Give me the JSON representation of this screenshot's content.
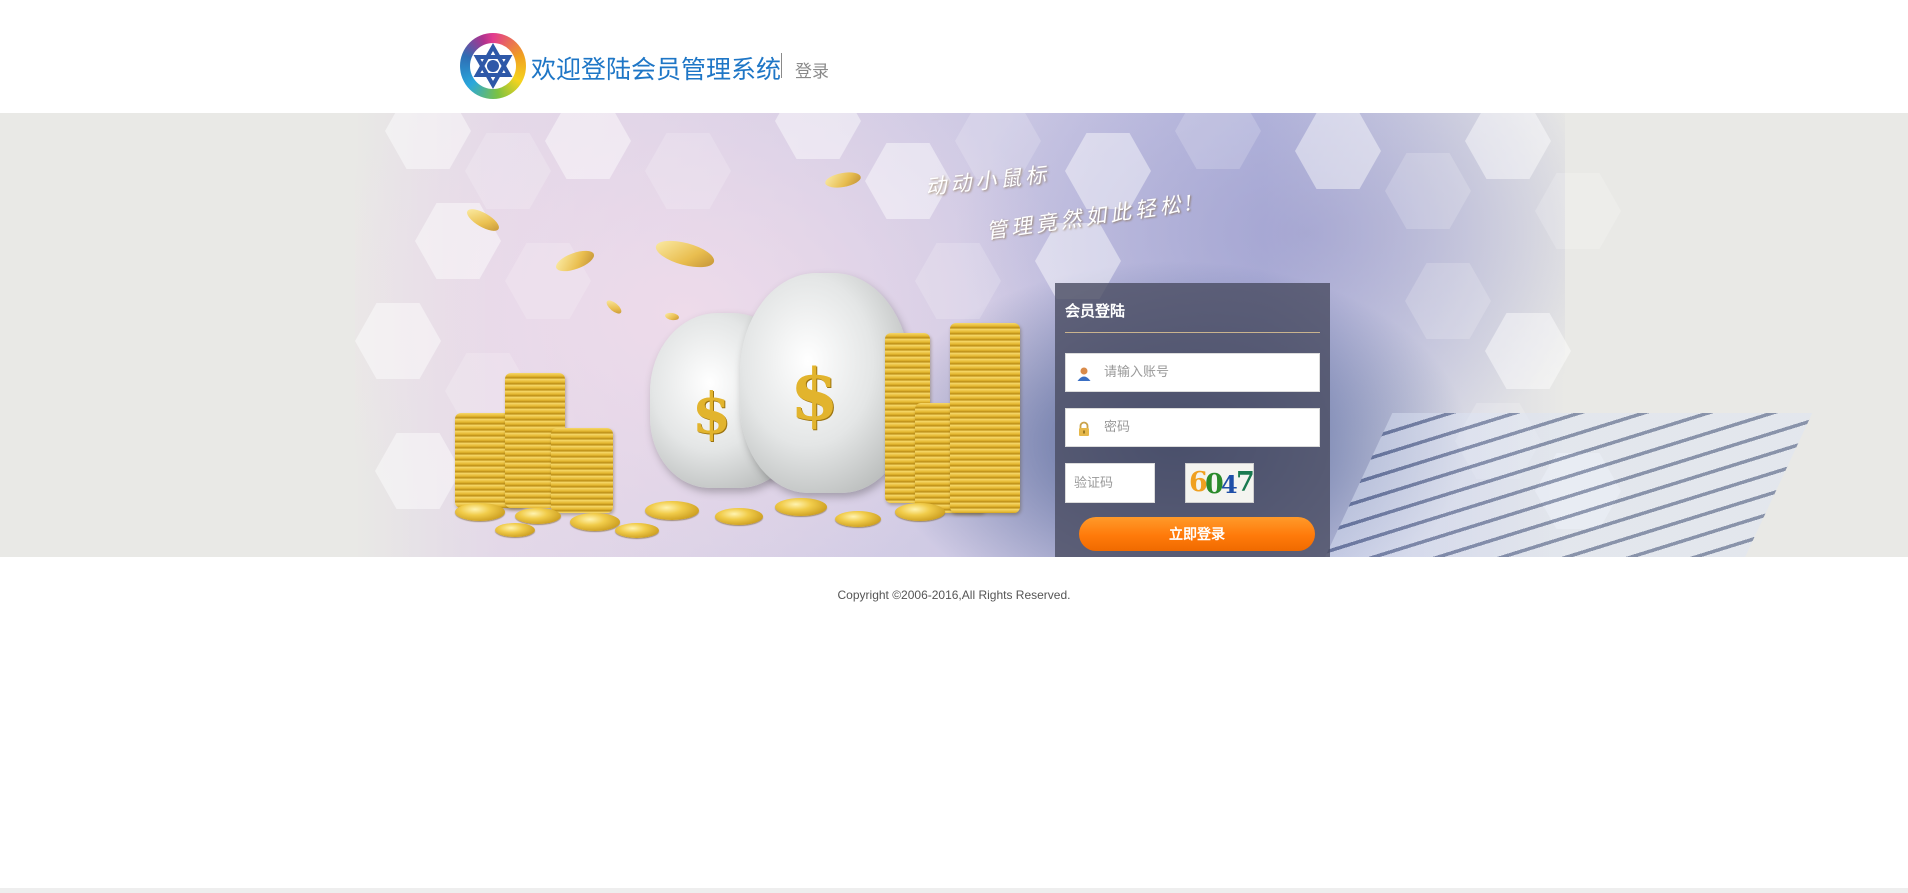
{
  "header": {
    "site_title": "欢迎登陆会员管理系统",
    "page_label": "登录"
  },
  "banner": {
    "slogan_line1": "动动小鼠标",
    "slogan_line2": "管理竟然如此轻松!"
  },
  "login": {
    "title": "会员登陆",
    "username_placeholder": "请输入账号",
    "password_placeholder": "密码",
    "captcha_placeholder": "验证码",
    "captcha_chars": [
      "6",
      "0",
      "4",
      "7"
    ],
    "captcha_colors": [
      "#f0a020",
      "#2a8a2a",
      "#1f4fa8",
      "#1a7a50"
    ],
    "submit_label": "立即登录"
  },
  "footer": {
    "copyright": "Copyright ©2006-2016,All Rights Reserved."
  },
  "colors": {
    "brand_blue": "#1e76c6",
    "button_orange": "#ff7a0a",
    "panel_bg": "#4a4c62"
  }
}
